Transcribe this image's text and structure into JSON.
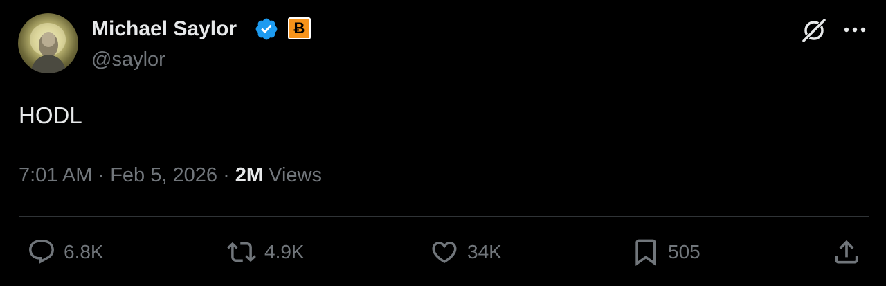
{
  "author": {
    "display_name": "Michael Saylor",
    "handle": "@saylor",
    "verified_icon": "verified-badge-icon",
    "affiliate_badge": "Ƀ",
    "affiliate_badge_color": "#f7931a",
    "verified_color": "#1d9bf0"
  },
  "tweet": {
    "text": "HODL",
    "time": "7:01 AM",
    "separator": "·",
    "date": "Feb 5, 2026",
    "views_count": "2M",
    "views_label": "Views"
  },
  "header_icons": [
    "grok-icon",
    "more-icon"
  ],
  "actions": {
    "reply": {
      "icon": "reply-icon",
      "count": "6.8K"
    },
    "retweet": {
      "icon": "retweet-icon",
      "count": "4.9K"
    },
    "like": {
      "icon": "like-icon",
      "count": "34K"
    },
    "bookmark": {
      "icon": "bookmark-icon",
      "count": "505"
    },
    "share": {
      "icon": "share-icon"
    }
  },
  "colors": {
    "background": "#000000",
    "primary_text": "#e7e9ea",
    "secondary_text": "#71767b",
    "divider": "#2f3336"
  }
}
